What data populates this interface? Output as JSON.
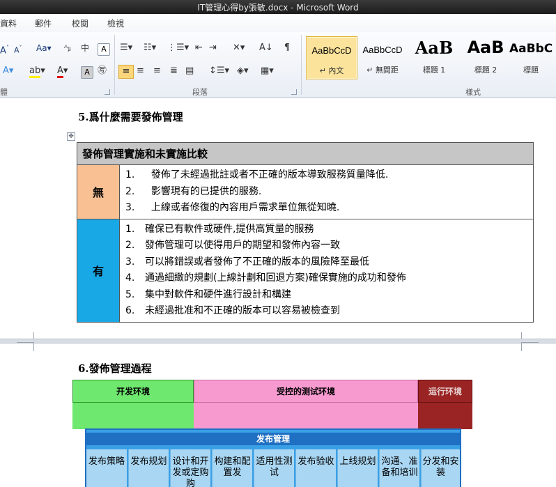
{
  "window": {
    "title": "IT管理心得by張敏.docx - Microsoft Word"
  },
  "tabs": [
    "資料",
    "郵件",
    "校閱",
    "檢視"
  ],
  "ribbon": {
    "groups": {
      "paragraph": "段落",
      "styles": "樣式"
    },
    "styles": [
      {
        "sample": "AaBbCcD",
        "name": "↵ 內文",
        "active": true
      },
      {
        "sample": "AaBbCcD",
        "name": "↵ 無間距",
        "active": false
      },
      {
        "sample": "AaB",
        "name": "標題 1",
        "active": false
      },
      {
        "sample": "AaB",
        "name": "標題 2",
        "active": false
      },
      {
        "sample": "AaBbC",
        "name": "標題",
        "active": false
      }
    ]
  },
  "document": {
    "section5_title": "5.爲什麼需要發佈管理",
    "comparison_table": {
      "header": "發佈管理實施和未實施比較",
      "rows": [
        {
          "key": "無",
          "key_color": "#f8c093",
          "items": [
            {
              "n": "1.",
              "text": "  發佈了未經過批註或者不正確的版本導致服務質量降低."
            },
            {
              "n": "2.",
              "text": "  影響現有的已提供的服務."
            },
            {
              "n": "3.",
              "text": "  上線或者修復的內容用戶需求單位無從知曉."
            }
          ]
        },
        {
          "key": "有",
          "key_color": "#19a8e6",
          "items": [
            {
              "n": "1.",
              "text": "確保已有軟件或硬件,提供高質量的服務"
            },
            {
              "n": "2.",
              "text": "發佈管理可以使得用戶的期望和發佈內容一致"
            },
            {
              "n": "3.",
              "text": "可以將錯誤或者發佈了不正確的版本的風險降至最低"
            },
            {
              "n": "4.",
              "text": "通過細緻的規劃(上線計劃和回退方案)確保實施的成功和發佈"
            },
            {
              "n": "5.",
              "text": "集中對軟件和硬件進行設計和構建"
            },
            {
              "n": "6.",
              "text": "未經過批准和不正確的版本可以容易被檢查到"
            }
          ]
        }
      ]
    },
    "section6_title": "6.發佈管理過程",
    "process_diagram": {
      "environments": [
        {
          "label": "开发环境",
          "color": "#6ee86e"
        },
        {
          "label": "受控的测试环境",
          "color": "#f79ad0"
        },
        {
          "label": "运行环境",
          "color": "#9a2424"
        }
      ],
      "management_title": "发布管理",
      "steps": [
        "发布策略",
        "发布规划",
        "设计和开发或定购购",
        "构建和配置发",
        "适用性测试",
        "发布验收",
        "上线规划",
        "沟通、准备和培训",
        "分发和安装"
      ]
    }
  }
}
